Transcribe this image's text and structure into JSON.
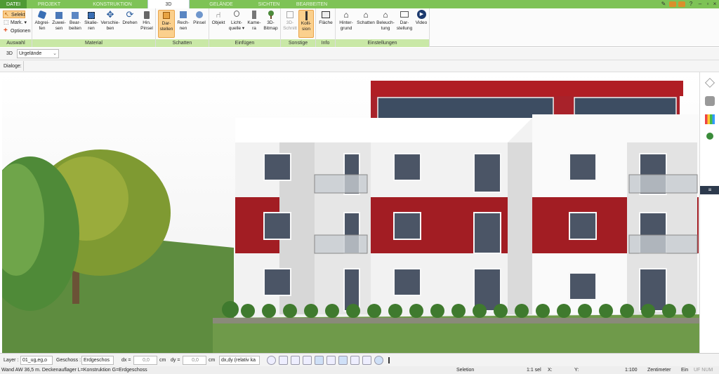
{
  "tabs": [
    "DATEI",
    "PROJEKT",
    "KONSTRUKTION",
    "3D",
    "GELÄNDE",
    "SICHTEN",
    "BEARBEITEN"
  ],
  "selection": {
    "select": "Selekt",
    "mark": "Mark.",
    "options": "Optionen"
  },
  "groups": [
    "Auswahl",
    "Material",
    "Schatten",
    "Einfügen",
    "Sonstige",
    "Info",
    "Einstellungen"
  ],
  "material": [
    "Abgrei-\nfen",
    "Zuwei-\nsen",
    "Bear-\nbeiten",
    "Skalie-\nren",
    "Verschie-\nben",
    "Drehen",
    "Hin.\nPinsel"
  ],
  "schatten": [
    "Dar-\nstellen",
    "Rech-\nnen",
    "Pinsel"
  ],
  "einfuegen": [
    "Objekt",
    "Licht-\nquelle ▾",
    "Kame-\nra",
    "3D-\nBitmap"
  ],
  "sonstige": [
    "3D-\nSchnitt",
    "Kolli-\nsion"
  ],
  "info": [
    "Fläche"
  ],
  "einstellungen": [
    "Hinter-\ngrund",
    "Schatten",
    "Beleuch-\ntung",
    "Dar-\nstellung",
    "Video"
  ],
  "view": {
    "mode": "3D",
    "terrain": "Urgelände"
  },
  "dialog_label": "Dialoge:",
  "bottom": {
    "layer_label": "Layer :",
    "layer_value": "01_ug,eg,o",
    "floor_label": "Geschoss :",
    "floor_value": "Erdgeschos",
    "dx_label": "dx =",
    "dx_value": "0,0",
    "dx_unit": "cm",
    "dy_label": "dy =",
    "dy_value": "0,0",
    "dy_unit": "cm",
    "rel_value": "dx,dy (relativ ka"
  },
  "status": {
    "message": "Wand AW 36,5 m. Deckenauflager L=Konstruktion G=Erdgeschoss",
    "mode": "Seletion",
    "sel": "1:1 sel",
    "x": "X:",
    "y": "Y:",
    "scale": "1:100",
    "unit": "Zentimeter",
    "ein": "Ein",
    "flags": "UF  NUM",
    "size": "7"
  },
  "colors": {
    "accent": "#7ec356",
    "brand_dark": "#4f9a34",
    "facade_red": "#a41f24",
    "ribbon_group": "#c9e8a6"
  }
}
